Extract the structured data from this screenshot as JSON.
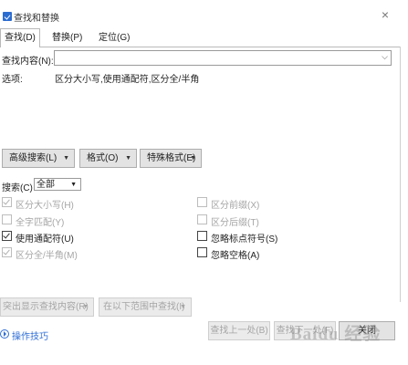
{
  "window": {
    "title": "查找和替换",
    "close_glyph": "×"
  },
  "tabs": [
    {
      "label": "查找(D)",
      "active": true
    },
    {
      "label": "替换(P)",
      "active": false
    },
    {
      "label": "定位(G)",
      "active": false
    }
  ],
  "find": {
    "label": "查找内容(N):",
    "value": "",
    "options_label": "选项:",
    "options_value": "区分大小写,使用通配符,区分全/半角"
  },
  "buttons": {
    "advanced": "高级搜索(L)",
    "format": "格式(O)",
    "special": "特殊格式(E)"
  },
  "search": {
    "label": "搜索(C)",
    "value": "全部"
  },
  "checkboxes": {
    "left": [
      {
        "label": "区分大小写(H)",
        "checked": true,
        "disabled": true
      },
      {
        "label": "全字匹配(Y)",
        "checked": false,
        "disabled": true
      },
      {
        "label": "使用通配符(U)",
        "checked": true,
        "disabled": false
      },
      {
        "label": "区分全/半角(M)",
        "checked": true,
        "disabled": true
      }
    ],
    "right": [
      {
        "label": "区分前缀(X)",
        "checked": false,
        "disabled": true
      },
      {
        "label": "区分后缀(T)",
        "checked": false,
        "disabled": true
      },
      {
        "label": "忽略标点符号(S)",
        "checked": false,
        "disabled": false
      },
      {
        "label": "忽略空格(A)",
        "checked": false,
        "disabled": false
      }
    ]
  },
  "bottom": {
    "highlight": "突出显示查找内容(R)",
    "find_in": "在以下范围中查找(I)",
    "tips": "操作技巧",
    "find_prev": "查找上一处(B)",
    "find_next": "查找下一处(F)",
    "close": "关闭",
    "watermark": "Baidu 经验"
  },
  "icons": {
    "app": "find-replace-app-icon",
    "close": "close-icon",
    "dropdown": "chevron-down-icon",
    "tips": "play-circle-icon"
  },
  "colors": {
    "link": "#2f6fd6",
    "button_bg": "#e3e3e3",
    "disabled_text": "#a5a5a5"
  }
}
